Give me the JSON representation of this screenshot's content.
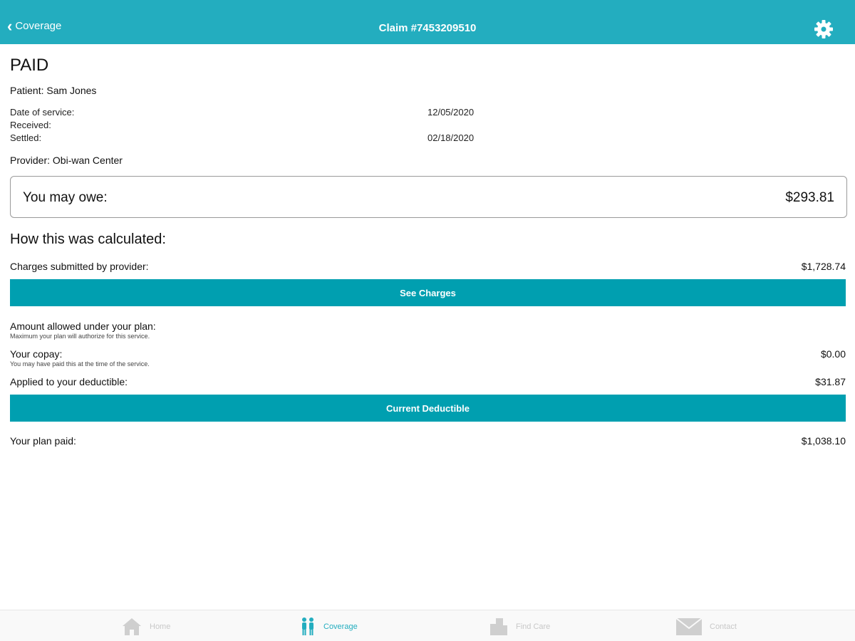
{
  "header": {
    "back_label": "Coverage",
    "title": "Claim #7453209510"
  },
  "claim": {
    "status": "PAID",
    "patient": "Patient: Sam Jones",
    "date_of_service_label": "Date of service:",
    "date_of_service_value": "12/05/2020",
    "received_label": "Received:",
    "settled_label": "Settled:",
    "settled_value": "02/18/2020",
    "provider": "Provider: Obi-wan Center"
  },
  "owe": {
    "label": "You may owe:",
    "value": "$293.81"
  },
  "calculation": {
    "title": "How this was calculated:",
    "charges_label": "Charges submitted by provider:",
    "charges_value": "$1,728.74",
    "see_charges_button": "See Charges",
    "allowed_label": "Amount allowed under your plan:",
    "allowed_sub": "Maximum your plan will authorize for this service.",
    "copay_label": "Your copay:",
    "copay_sub": "You may have paid this at the time of the service.",
    "copay_value": "$0.00",
    "deductible_label": "Applied to your deductible:",
    "deductible_value": "$31.87",
    "current_deductible_button": "Current Deductible",
    "plan_paid_label": "Your plan paid:",
    "plan_paid_value": "$1,038.10"
  },
  "tabs": [
    {
      "label": "Home",
      "icon": "home-icon"
    },
    {
      "label": "Coverage",
      "icon": "people-icon"
    },
    {
      "label": "Find Care",
      "icon": "building-icon"
    },
    {
      "label": "Contact",
      "icon": "envelope-icon"
    }
  ],
  "colors": {
    "accent": "#23adbf",
    "button": "#009fb0"
  }
}
